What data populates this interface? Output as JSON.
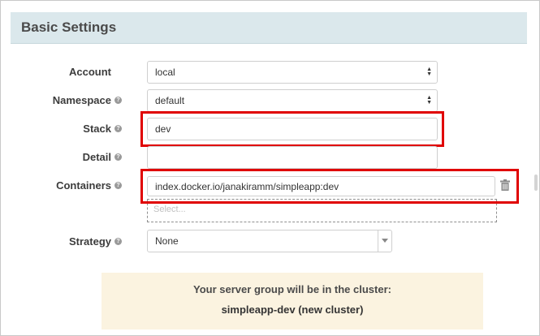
{
  "panel": {
    "title": "Basic Settings"
  },
  "form": {
    "account": {
      "label": "Account",
      "value": "local"
    },
    "namespace": {
      "label": "Namespace",
      "value": "default"
    },
    "stack": {
      "label": "Stack",
      "value": "dev"
    },
    "detail": {
      "label": "Detail",
      "value": ""
    },
    "containers": {
      "label": "Containers",
      "value": "index.docker.io/janakiramm/simpleapp:dev",
      "select_placeholder": "Select..."
    },
    "strategy": {
      "label": "Strategy",
      "value": "None"
    }
  },
  "info": {
    "line1": "Your server group will be in the cluster:",
    "line2": "simpleapp-dev (new cluster)"
  },
  "icons": {
    "help": "question-circle-icon",
    "delete": "trash-icon",
    "select_arrows": "up-down-arrows-icon",
    "dropdown": "chevron-down-icon"
  },
  "colors": {
    "header_bg": "#dbe8ec",
    "highlight": "#e00000",
    "info_bg": "#fbf3e0"
  }
}
